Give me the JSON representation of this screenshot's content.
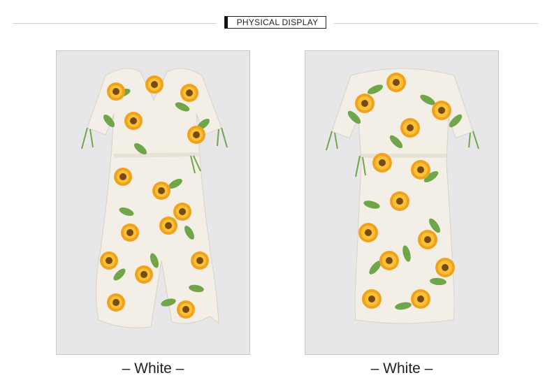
{
  "header": {
    "title": "PHYSICAL DISPLAY"
  },
  "photos": [
    {
      "view": "front",
      "caption": "– White –"
    },
    {
      "view": "back",
      "caption": "– White –"
    }
  ],
  "colors": {
    "photo_bg": "#e7e7e9",
    "dress_base": "#f3efe6",
    "sunflower": "#f2a21a",
    "sunflower_center": "#7a4a10",
    "leaf": "#6fa64a"
  }
}
